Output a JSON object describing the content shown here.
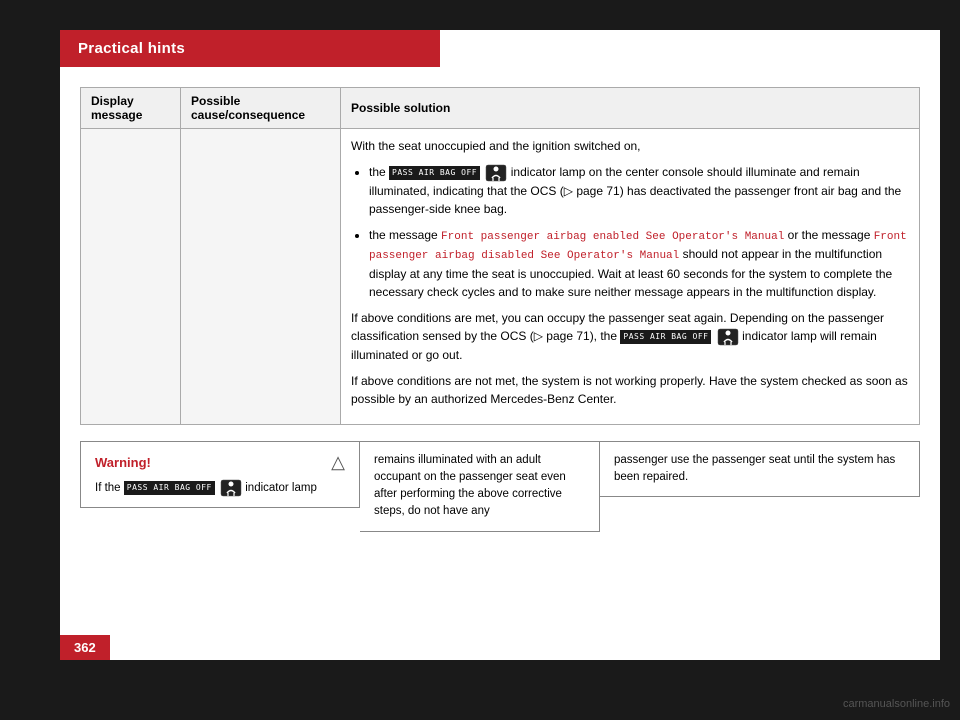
{
  "header": {
    "title": "Practical hints"
  },
  "page_number": "362",
  "watermark": "carmanualsonline.info",
  "table": {
    "columns": [
      "Display message",
      "Possible cause/consequence",
      "Possible solution"
    ],
    "solution_content": {
      "intro": "With the seat unoccupied and the ignition switched on,",
      "bullets": [
        {
          "text_before": "the",
          "badge": "PASS AIR BAG OFF",
          "text_after": "indicator lamp on the center console should illuminate and remain illuminated, indicating that the OCS (▷ page 71) has deactivated the passenger front air bag and the passenger-side knee bag."
        },
        {
          "text_before": "the message",
          "mono1": "Front passenger airbag enabled See Operator's Manual",
          "text_middle": "or the message",
          "mono2": "Front passenger airbag disabled See Operator's Manual",
          "text_after": "should not appear in the multifunction display at any time the seat is unoccupied. Wait at least 60 seconds for the system to complete the necessary check cycles and to make sure neither message appears in the multifunction display."
        }
      ],
      "para1": "If above conditions are met, you can occupy the passenger seat again. Depending on the passenger classification sensed by the OCS (▷ page 71), the",
      "para1_badge": "PASS AIR BAG OFF",
      "para1_after": "indicator lamp will remain illuminated or go out.",
      "para2": "If above conditions are not met, the system is not working properly. Have the system checked as soon as possible by an authorized Mercedes-Benz Center."
    }
  },
  "warning": {
    "label": "Warning!",
    "line1_before": "If the",
    "line1_badge": "PASS AIR BAG OFF",
    "line1_after": "indicator lamp"
  },
  "middle_box": "remains illuminated with an adult occupant on the passenger seat even after performing the above corrective steps, do not have any",
  "right_box": "passenger use the passenger seat until the system has been repaired."
}
